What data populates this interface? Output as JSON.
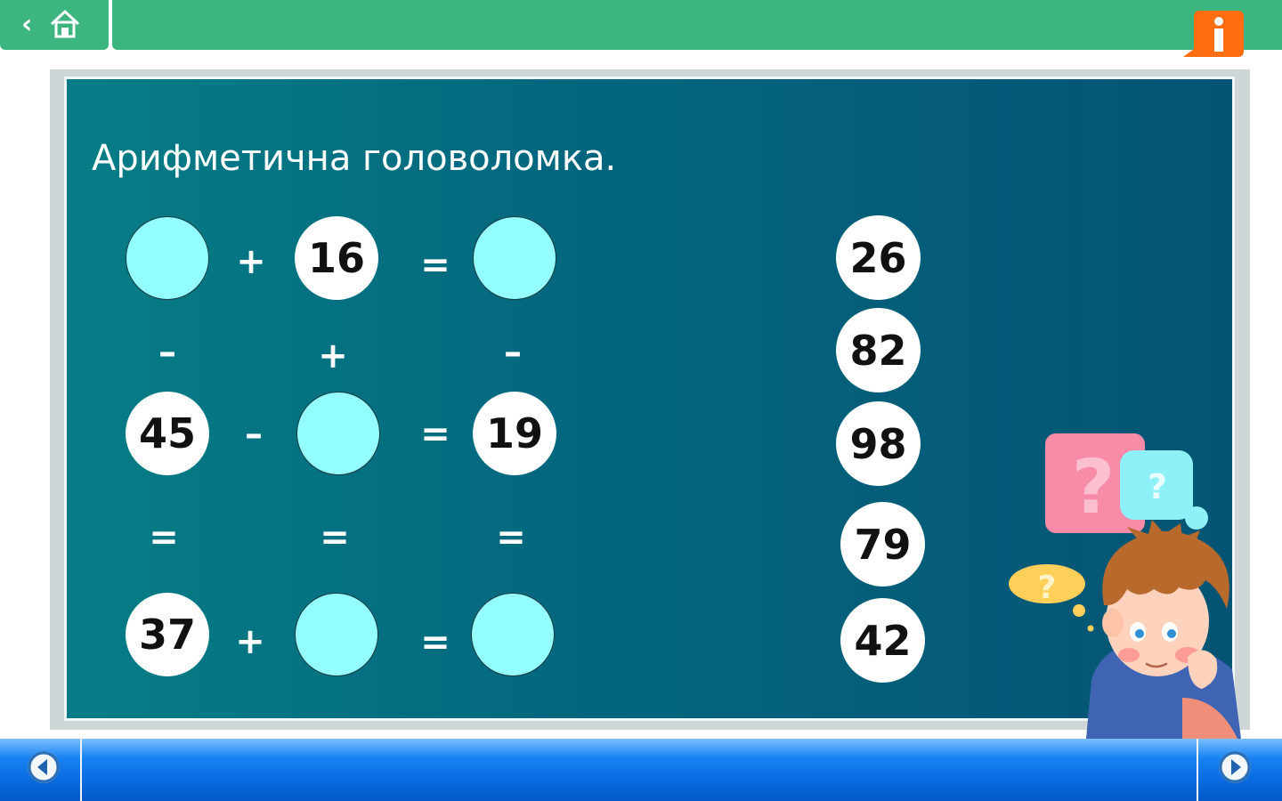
{
  "top_bar": {
    "back_icon": "chevron-left-icon",
    "home_icon": "home-icon",
    "info_icon": "info-icon",
    "colors": {
      "bar": "#3db581",
      "info": "#ff6d12"
    }
  },
  "slide": {
    "title": "Арифметична головоломка.",
    "puzzle": {
      "row1": {
        "a": "",
        "op1": "+",
        "b": "16",
        "eq": "=",
        "c": ""
      },
      "col_ops": {
        "c1": "–",
        "c2": "+",
        "c3": "–"
      },
      "row2": {
        "a": "45",
        "op1": "–",
        "b": "",
        "eq": "=",
        "c": "19"
      },
      "col_eqs": {
        "c1": "=",
        "c2": "=",
        "c3": "="
      },
      "row3": {
        "a": "37",
        "op1": "+",
        "b": "",
        "eq": "=",
        "c": ""
      }
    },
    "answer_tiles": [
      "26",
      "82",
      "98",
      "79",
      "42"
    ],
    "illustration": {
      "bubble_text": "?"
    },
    "colors": {
      "board_start": "#067d86",
      "board_end": "#055474",
      "empty_circle": "#93ffff"
    }
  },
  "bottom_nav": {
    "prev_icon": "arrow-left-icon",
    "next_icon": "arrow-right-icon",
    "color": "#0a6fe4"
  }
}
